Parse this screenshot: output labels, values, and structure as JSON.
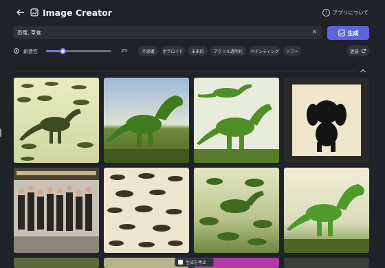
{
  "header": {
    "title": "Image Creator",
    "about_label": "アプリについて"
  },
  "search": {
    "value": "恐竜, 草食"
  },
  "generate_button": {
    "label": "生成"
  },
  "creativity": {
    "label": "創造性",
    "value": 25,
    "max": 100
  },
  "style_chips": [
    "不思議",
    "ポラロイド",
    "未来的",
    "アクリル透明化",
    "ペインティング",
    "ソフト"
  ],
  "refresh_label": "更新",
  "stop_label": "生成を停止",
  "colors": {
    "background": "#1f2329",
    "accent": "#5b64dc",
    "chip": "#2f343c"
  },
  "images": [
    {
      "description": "dinosaur-herd-sketch"
    },
    {
      "description": "green-trex-field"
    },
    {
      "description": "green-dinosaur-pair"
    },
    {
      "description": "black-puppy-paper-cutout"
    },
    {
      "description": "group-photo-crowd"
    },
    {
      "description": "dinosaur-silhouette-pattern"
    },
    {
      "description": "dinosaur-herd-landscape"
    },
    {
      "description": "green-trex-jungle"
    },
    {
      "description": "partial-tile-1"
    },
    {
      "description": "partial-tile-2"
    },
    {
      "description": "partial-tile-3"
    },
    {
      "description": "partial-tile-4"
    }
  ]
}
